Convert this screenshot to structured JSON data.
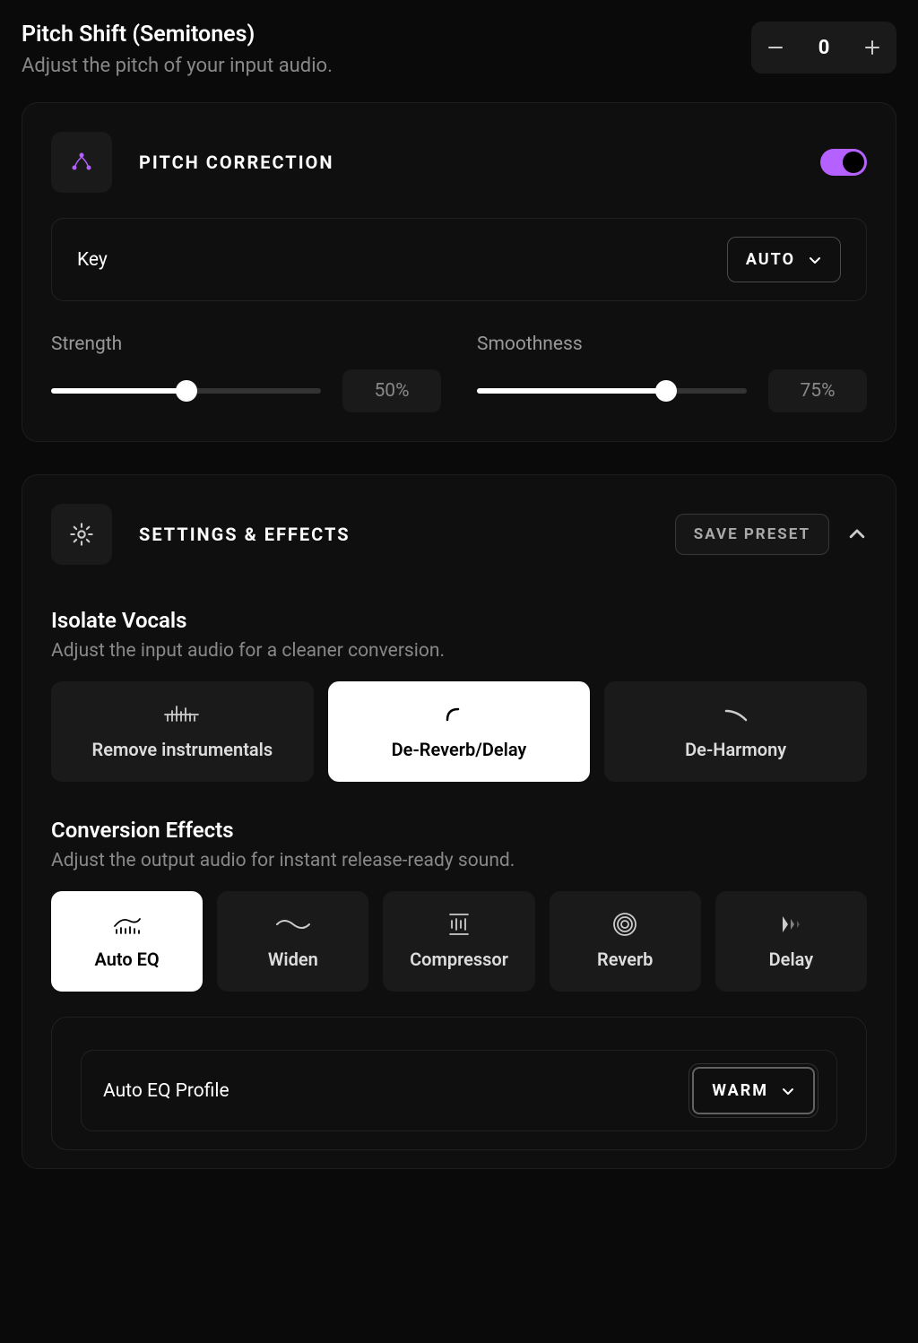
{
  "pitch_shift": {
    "title": "Pitch Shift (Semitones)",
    "subtitle": "Adjust the pitch of your input audio.",
    "value": "0"
  },
  "pitch_correction": {
    "title": "PITCH CORRECTION",
    "enabled": true,
    "key_label": "Key",
    "key_value": "AUTO",
    "strength": {
      "label": "Strength",
      "value": "50%",
      "percent": 50
    },
    "smoothness": {
      "label": "Smoothness",
      "value": "75%",
      "percent": 75
    }
  },
  "settings": {
    "title": "SETTINGS & EFFECTS",
    "save_label": "SAVE PRESET",
    "isolate": {
      "title": "Isolate Vocals",
      "subtitle": "Adjust the input audio for a cleaner conversion.",
      "options": [
        {
          "label": "Remove instrumentals",
          "active": false
        },
        {
          "label": "De-Reverb/Delay",
          "active": true
        },
        {
          "label": "De-Harmony",
          "active": false
        }
      ]
    },
    "conversion": {
      "title": "Conversion Effects",
      "subtitle": "Adjust the output audio for instant release-ready sound.",
      "options": [
        {
          "label": "Auto EQ",
          "active": true
        },
        {
          "label": "Widen",
          "active": false
        },
        {
          "label": "Compressor",
          "active": false
        },
        {
          "label": "Reverb",
          "active": false
        },
        {
          "label": "Delay",
          "active": false
        }
      ]
    },
    "auto_eq": {
      "label": "Auto EQ Profile",
      "value": "WARM"
    }
  }
}
